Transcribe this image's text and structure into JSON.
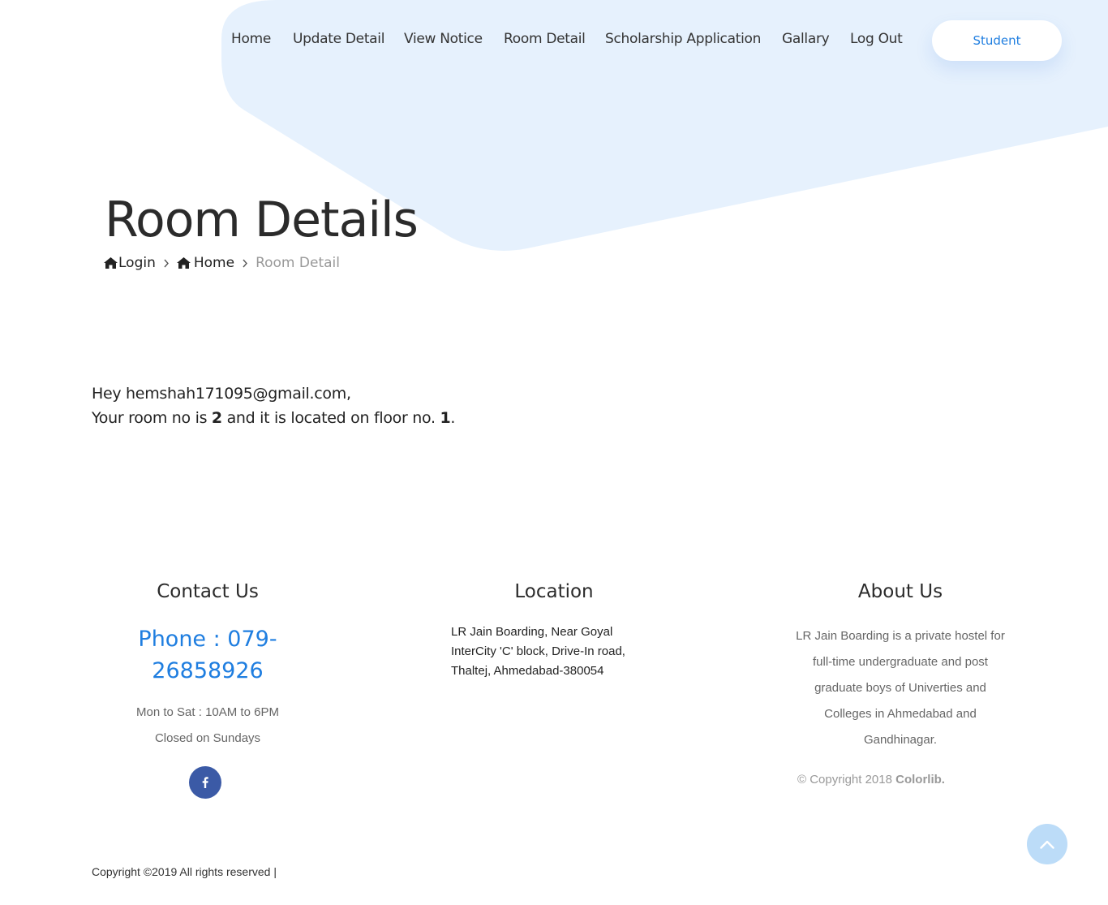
{
  "nav": {
    "items": [
      {
        "label": "Home"
      },
      {
        "label": "Update Detail"
      },
      {
        "label": "View Notice"
      },
      {
        "label": "Room Detail"
      },
      {
        "label": "Scholarship Application"
      },
      {
        "label": "Gallary"
      },
      {
        "label": "Log Out"
      }
    ],
    "student_button": "Student"
  },
  "colors": {
    "accent": "#1f7ee0",
    "hero_shape": "#e6f1fd",
    "facebook": "#3b5aa6",
    "scroll_top": "#bcdcf8"
  },
  "hero": {
    "title": "Room Details",
    "breadcrumb": {
      "login": "Login",
      "home": "Home",
      "current": "Room Detail",
      "home_icon": "home-icon",
      "separator_icon": "chevron-right-icon"
    }
  },
  "message": {
    "greeting": "Hey hemshah171095@gmail.com,",
    "line_prefix": "Your room no is ",
    "room_no": "2",
    "line_middle": " and it is located on floor no. ",
    "floor_no": "1",
    "line_suffix": "."
  },
  "footer": {
    "contact": {
      "title": "Contact Us",
      "phone": "Phone : 079-26858926",
      "hours": "Mon to Sat : 10AM to 6PM",
      "closed": "Closed on Sundays",
      "social_icon": "facebook-icon"
    },
    "location": {
      "title": "Location",
      "address": "LR Jain Boarding, Near Goyal InterCity 'C' block, Drive-In road, Thaltej, Ahmedabad-380054"
    },
    "about": {
      "title": "About Us",
      "text": "LR Jain Boarding is a private hostel for full-time undergraduate and post graduate boys of Univerties and Colleges in Ahmedabad and Gandhinagar.",
      "copyright_prefix": "© Copyright 2018 ",
      "copyright_brand": "Colorlib."
    },
    "bottom_copyright": "Copyright ©2019 All rights reserved |",
    "scroll_top_icon": "chevron-up-icon"
  }
}
